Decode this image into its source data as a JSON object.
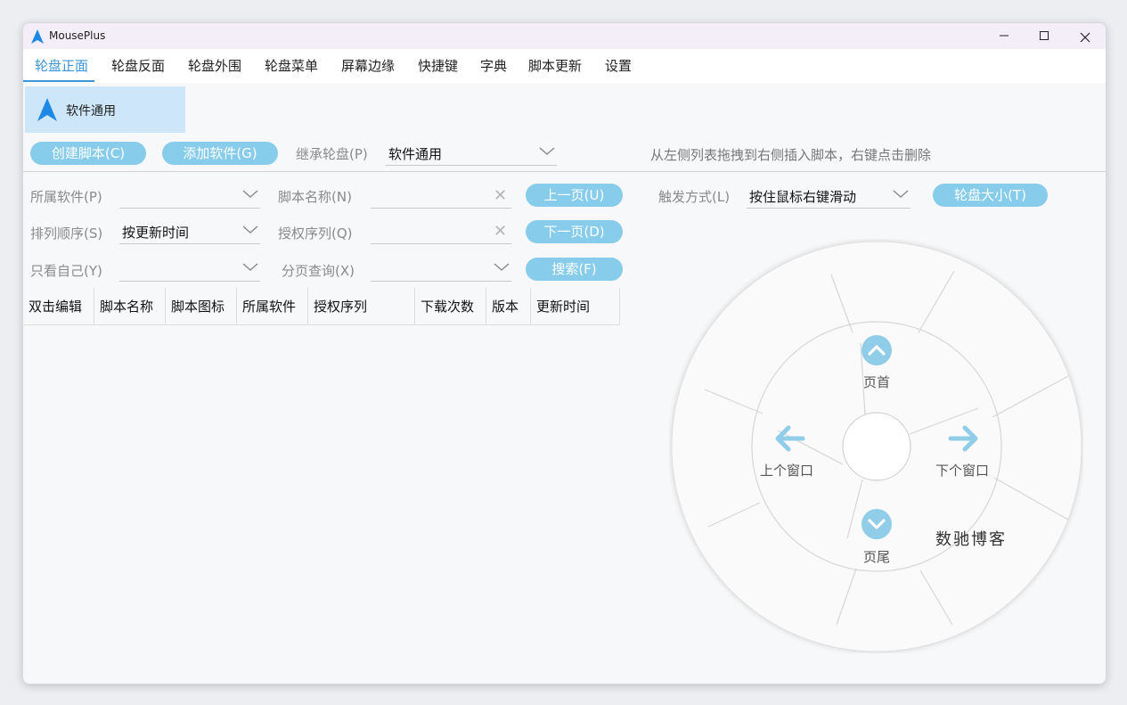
{
  "window": {
    "title": "MousePlus",
    "min_icon": "minimize-icon",
    "max_icon": "maximize-icon",
    "close_icon": "close-icon"
  },
  "menu": {
    "items": [
      "轮盘正面",
      "轮盘反面",
      "轮盘外围",
      "轮盘菜单",
      "屏幕边缘",
      "快捷键",
      "字典",
      "脚本更新",
      "设置"
    ],
    "active_index": 0
  },
  "software_card": {
    "label": "软件通用",
    "icon": "arrow-up-logo-icon"
  },
  "toolbar": {
    "create_script": "创建脚本(C)",
    "add_software": "添加软件(G)",
    "inherit_label": "继承轮盘(P)",
    "inherit_value": "软件通用",
    "hint": "从左侧列表拖拽到右侧插入脚本，右键点击删除"
  },
  "filters": {
    "software_label": "所属软件(P)",
    "software_value": "",
    "script_name_label": "脚本名称(N)",
    "script_name_value": "",
    "sort_label": "排列顺序(S)",
    "sort_value": "按更新时间",
    "license_label": "授权序列(Q)",
    "license_value": "",
    "only_me_label": "只看自己(Y)",
    "only_me_value": "",
    "page_query_label": "分页查询(X)",
    "page_query_value": "",
    "prev_page": "上一页(U)",
    "next_page": "下一页(D)",
    "search": "搜索(F)"
  },
  "trigger": {
    "label": "触发方式(L)",
    "value": "按住鼠标右键滑动",
    "wheel_size": "轮盘大小(T)"
  },
  "table": {
    "columns": [
      "双击编辑",
      "脚本名称",
      "脚本图标",
      "所属软件",
      "授权序列",
      "下载次数",
      "版本",
      "更新时间"
    ]
  },
  "wheel": {
    "top": "页首",
    "left": "上个窗口",
    "right": "下个窗口",
    "bottom": "页尾",
    "accent": "#8fcde9"
  },
  "watermark": "数驰博客"
}
